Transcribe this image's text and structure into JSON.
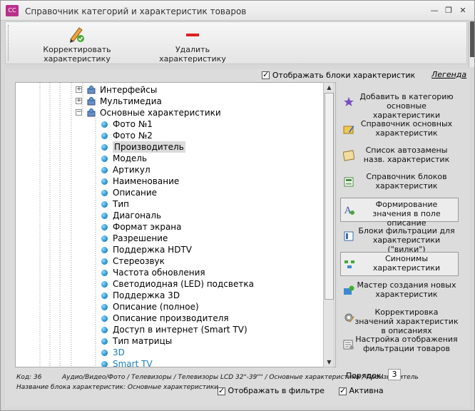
{
  "window": {
    "title": "Справочник категорий и характеристик товаров",
    "app_icon_text": "CC"
  },
  "toolbar": {
    "edit_label": "Корректировать характеристику",
    "delete_label": "Удалить характеристику"
  },
  "options": {
    "show_blocks_label": "Отображать блоки характеристик",
    "show_blocks_checked": true,
    "legend_label": "Легенда"
  },
  "tree": {
    "parents": [
      {
        "label": "Интерфейсы",
        "expanded": false
      },
      {
        "label": "Мультимедиа",
        "expanded": false
      },
      {
        "label": "Основные характеристики",
        "expanded": true
      }
    ],
    "children": [
      {
        "label": "Фото №1"
      },
      {
        "label": "Фото №2"
      },
      {
        "label": "Производитель",
        "selected": true
      },
      {
        "label": "Модель"
      },
      {
        "label": "Артикул"
      },
      {
        "label": "Наименование"
      },
      {
        "label": "Описание"
      },
      {
        "label": "Тип"
      },
      {
        "label": "Диагональ"
      },
      {
        "label": "Формат экрана"
      },
      {
        "label": "Разрешение"
      },
      {
        "label": "Поддержка HDTV"
      },
      {
        "label": "Стереозвук"
      },
      {
        "label": "Частота обновления"
      },
      {
        "label": "Светодиодная (LED) подсветка"
      },
      {
        "label": "Поддержка 3D"
      },
      {
        "label": "Описание (полное)"
      },
      {
        "label": "Описание производителя"
      },
      {
        "label": "Доступ в интернет (Smart TV)"
      },
      {
        "label": "Тип матрицы"
      },
      {
        "label": "3D",
        "color": "#1a7fc0"
      },
      {
        "label": "Smart TV",
        "color": "#1a7fc0"
      }
    ]
  },
  "side_buttons": [
    {
      "label": "Добавить в категорию основные характеристики",
      "icon": "star-puzzle-icon"
    },
    {
      "label": "Справочник основных характеристик",
      "icon": "folder-edit-icon"
    },
    {
      "label": "Список автозамены назв. характеристик",
      "icon": "list-replace-icon"
    },
    {
      "label": "Справочник блоков характеристик",
      "icon": "blocks-icon"
    },
    {
      "label": "Формирование значения в поле описание",
      "icon": "text-build-icon"
    },
    {
      "label": "Блоки фильтрации для характеристики (\"вилки\")",
      "icon": "filter-block-icon"
    },
    {
      "label": "Синонимы характеристики",
      "icon": "synonyms-icon"
    },
    {
      "label": "Мастер создания новых характеристик",
      "icon": "wizard-icon"
    },
    {
      "label": "Корректировка значений характеристик в описаниях",
      "icon": "gear-edit-icon"
    },
    {
      "label": "Настройка отображения фильтрации товаров",
      "icon": "filter-settings-icon"
    }
  ],
  "footer": {
    "code_text": "Код: 36",
    "path_text": "Аудио/Видео/Фото / Телевизоры / Телевизоры LCD 32\"-39\"\" / Основные характеристики / Производитель",
    "block_name_text": "Название блока характеристик: Основные характеристики",
    "order_label": "Порядок:",
    "order_value": "3",
    "show_in_filter_label": "Отображать в фильтре",
    "show_in_filter_checked": true,
    "active_label": "Активна",
    "active_checked": true
  }
}
